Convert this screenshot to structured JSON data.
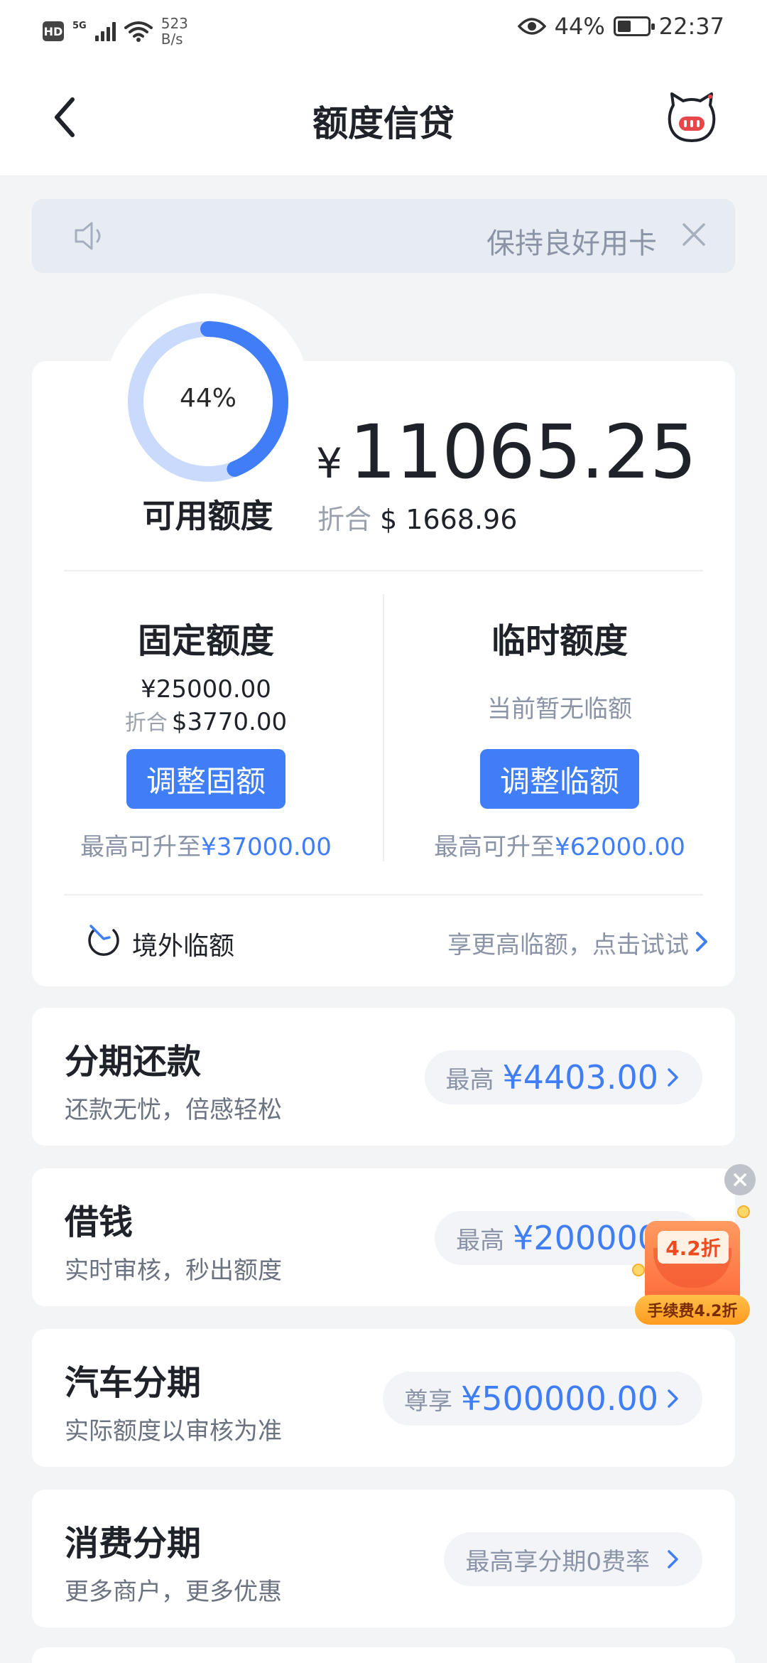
{
  "status_bar": {
    "hd": "HD",
    "network": "5G",
    "speed_value": "523",
    "speed_unit": "B/s",
    "battery": "44%",
    "time": "22:37"
  },
  "nav": {
    "title": "额度信贷"
  },
  "notice": {
    "text": "保持良好用卡"
  },
  "credit": {
    "ring_percent_value": 44,
    "ring_percent_text": "44%",
    "available_label": "可用额度",
    "currency_symbol": "¥",
    "available_amount": "11065.25",
    "usd_prefix": "折合",
    "usd_amount": "$ 1668.96",
    "fixed": {
      "title": "固定额度",
      "amount": "¥25000.00",
      "usd_prefix": "折合",
      "usd_amount": "$3770.00",
      "button": "调整固额",
      "max_prefix": "最高可升至",
      "max_value": "¥37000.00"
    },
    "temporary": {
      "title": "临时额度",
      "status": "当前暂无临额",
      "button": "调整临额",
      "max_prefix": "最高可升至",
      "max_value": "¥62000.00"
    },
    "overseas": {
      "label": "境外临额",
      "link": "享更高临额，点击试试"
    }
  },
  "services": [
    {
      "title": "分期还款",
      "subtitle": "还款无忧，倍感轻松",
      "pill_prefix": "最高",
      "pill_value": "¥4403.00"
    },
    {
      "title": "借钱",
      "subtitle": "实时审核，秒出额度",
      "pill_prefix": "最高",
      "pill_value": "¥200000"
    },
    {
      "title": "汽车分期",
      "subtitle": "实际额度以审核为准",
      "pill_prefix": "尊享",
      "pill_value": "¥500000.00"
    },
    {
      "title": "消费分期",
      "subtitle": "更多商户，更多优惠",
      "pill_prefix": "最高享分期0费率",
      "pill_value": ""
    }
  ],
  "promo": {
    "tag": "4.2折",
    "banner": "手续费4.2折"
  },
  "colors": {
    "accent": "#3f7ef6",
    "ring_track": "#c9dafd",
    "page_bg": "#f3f4f6",
    "promo_orange": "#ff6a3a"
  }
}
